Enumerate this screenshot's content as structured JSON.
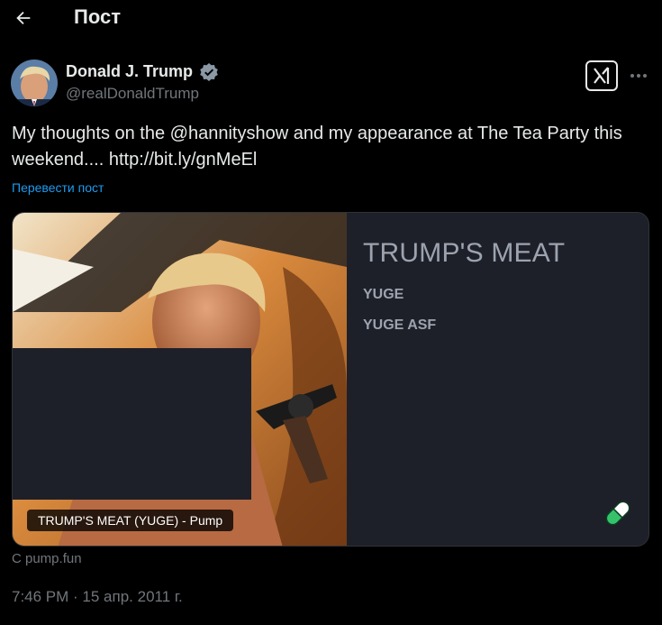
{
  "header": {
    "title": "Пост"
  },
  "post": {
    "author_name": "Donald J. Trump",
    "handle": "@realDonaldTrump",
    "text": "My thoughts on the @hannityshow and my appearance at The Tea Party this weekend.... http://bit.ly/gnMeEl",
    "translate_label": "Перевести пост",
    "timestamp": "7:46 PM · 15 апр. 2011 г."
  },
  "card": {
    "title": "TRUMP'S MEAT",
    "line1": "YUGE",
    "line2": "YUGE ASF",
    "caption": "TRUMP'S MEAT (YUGE) - Pump",
    "source": "С pump.fun"
  },
  "icons": {
    "back": "arrow-left-icon",
    "verified": "verified-badge-icon",
    "grok": "grok-icon",
    "more": "more-dots-icon",
    "pill": "pill-icon"
  },
  "colors": {
    "background": "#000000",
    "text": "#e7e9ea",
    "secondary": "#71767b",
    "link": "#1d9bf0",
    "card_bg": "#1e2029",
    "verified": "#8b98a5"
  }
}
